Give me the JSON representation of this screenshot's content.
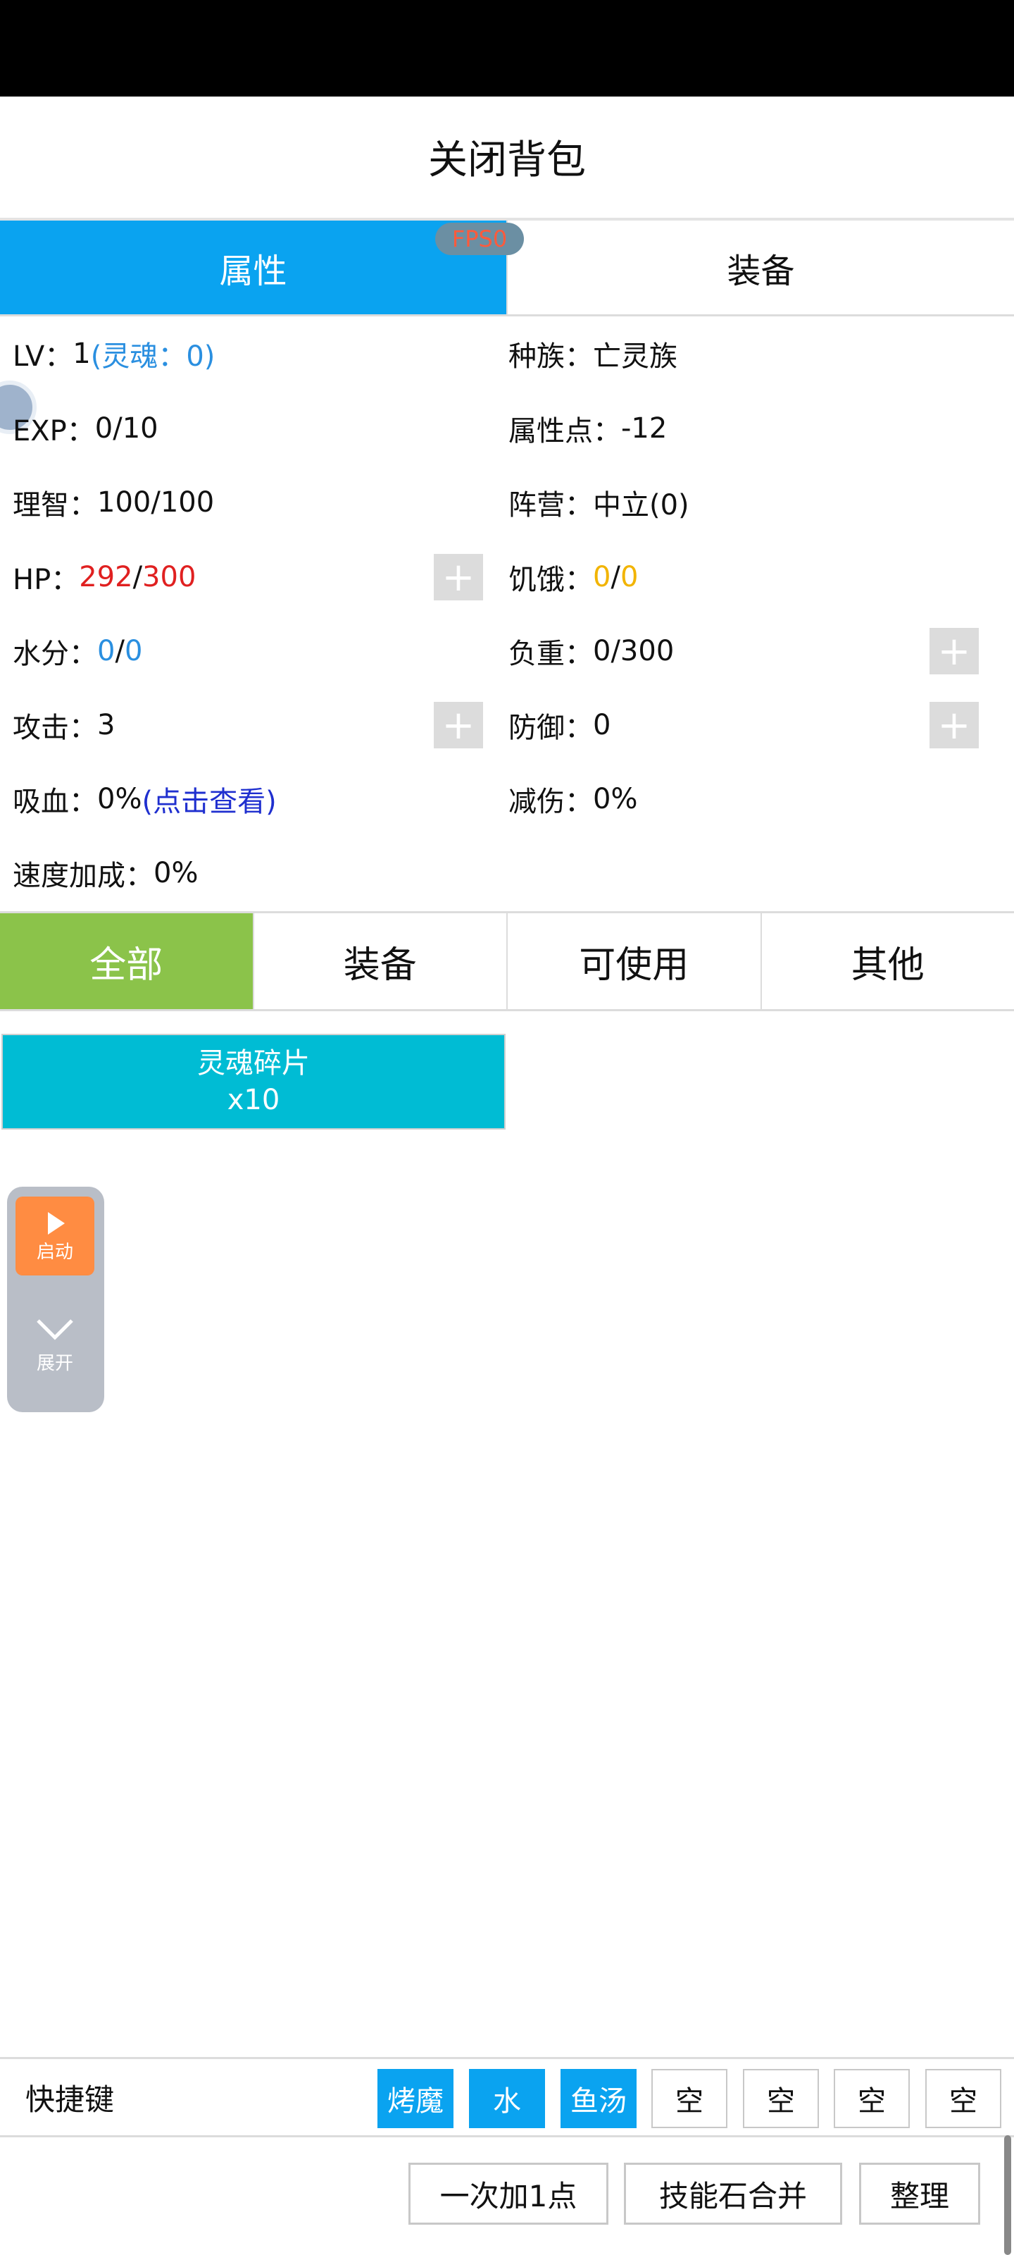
{
  "header": {
    "title": "关闭背包"
  },
  "fps_badge": "FPS0",
  "main_tabs": [
    {
      "label": "属性"
    },
    {
      "label": "装备"
    }
  ],
  "attributes": {
    "lv_label": "LV：",
    "lv_value": "1",
    "lv_soul": "(灵魂：0)",
    "race_label": "种族：",
    "race_value": "亡灵族",
    "exp_label": "EXP：",
    "exp_value": "0/10",
    "attr_points_label": "属性点：",
    "attr_points_value": "-12",
    "sanity_label": "理智：",
    "sanity_value": "100/100",
    "camp_label": "阵营：",
    "camp_value": "中立(0)",
    "hp_label": "HP：",
    "hp_current": "292",
    "hp_sep": "/",
    "hp_max": "300",
    "hunger_label": "饥饿：",
    "hunger_current": "0",
    "hunger_sep": "/",
    "hunger_max": "0",
    "water_label": "水分：",
    "water_current": "0",
    "water_sep": "/",
    "water_max": "0",
    "load_label": "负重：",
    "load_value": "0/300",
    "attack_label": "攻击：",
    "attack_value": "3",
    "defense_label": "防御：",
    "defense_value": "0",
    "lifesteal_label": "吸血：",
    "lifesteal_value": "0%",
    "lifesteal_link": "(点击查看)",
    "dmg_reduce_label": "减伤：",
    "dmg_reduce_value": "0%",
    "speed_label": "速度加成：",
    "speed_value": "0%",
    "plus_symbol": "+"
  },
  "categories": [
    {
      "label": "全部"
    },
    {
      "label": "装备"
    },
    {
      "label": "可使用"
    },
    {
      "label": "其他"
    }
  ],
  "inventory": [
    {
      "name": "灵魂碎片",
      "count": "x10"
    }
  ],
  "float_panel": {
    "start_label": "启动",
    "expand_label": "展开"
  },
  "hotkeys": {
    "label": "快捷键",
    "slots": [
      "烤魔",
      "水",
      "鱼汤",
      "空",
      "空",
      "空",
      "空"
    ]
  },
  "bottom_buttons": {
    "add_one": "一次加1点",
    "merge": "技能石合并",
    "sort": "整理"
  },
  "colors": {
    "tab_active": "#0aa3f0",
    "category_active": "#8bc34a",
    "item_bg": "#00bcd4",
    "hp_red": "#e02020",
    "hunger_gold": "#f2b400",
    "soul_blue": "#2a8fe0",
    "start_orange": "#ff8c42"
  }
}
